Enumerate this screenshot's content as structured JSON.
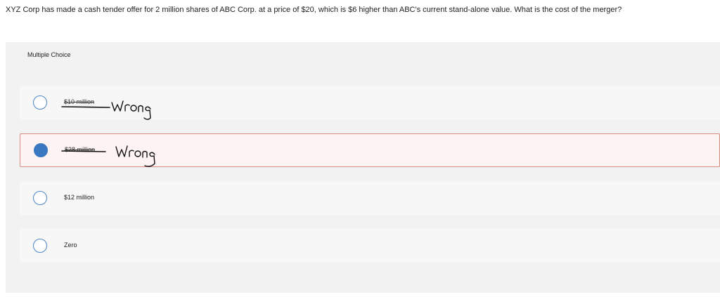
{
  "question": {
    "text": "XYZ Corp has made a cash tender offer for 2 million shares of ABC Corp. at a price of $20, which is $6 higher than ABC's current stand-alone value. What is the cost of the merger?"
  },
  "panel": {
    "header": "Multiple Choice"
  },
  "options": [
    {
      "label": "$10 million",
      "selected": false,
      "struck": true
    },
    {
      "label": "$28 million",
      "selected": true,
      "struck": true
    },
    {
      "label": "$12 million",
      "selected": false,
      "struck": false
    },
    {
      "label": "Zero",
      "selected": false,
      "struck": false
    }
  ],
  "annotations": [
    {
      "text": "Wrong"
    },
    {
      "text": "Wrong"
    }
  ],
  "colors": {
    "radio_border": "#4a86c8",
    "radio_selected": "#3a78c2",
    "selected_border": "#d98b86",
    "selected_bg": "#fdf3f2"
  }
}
